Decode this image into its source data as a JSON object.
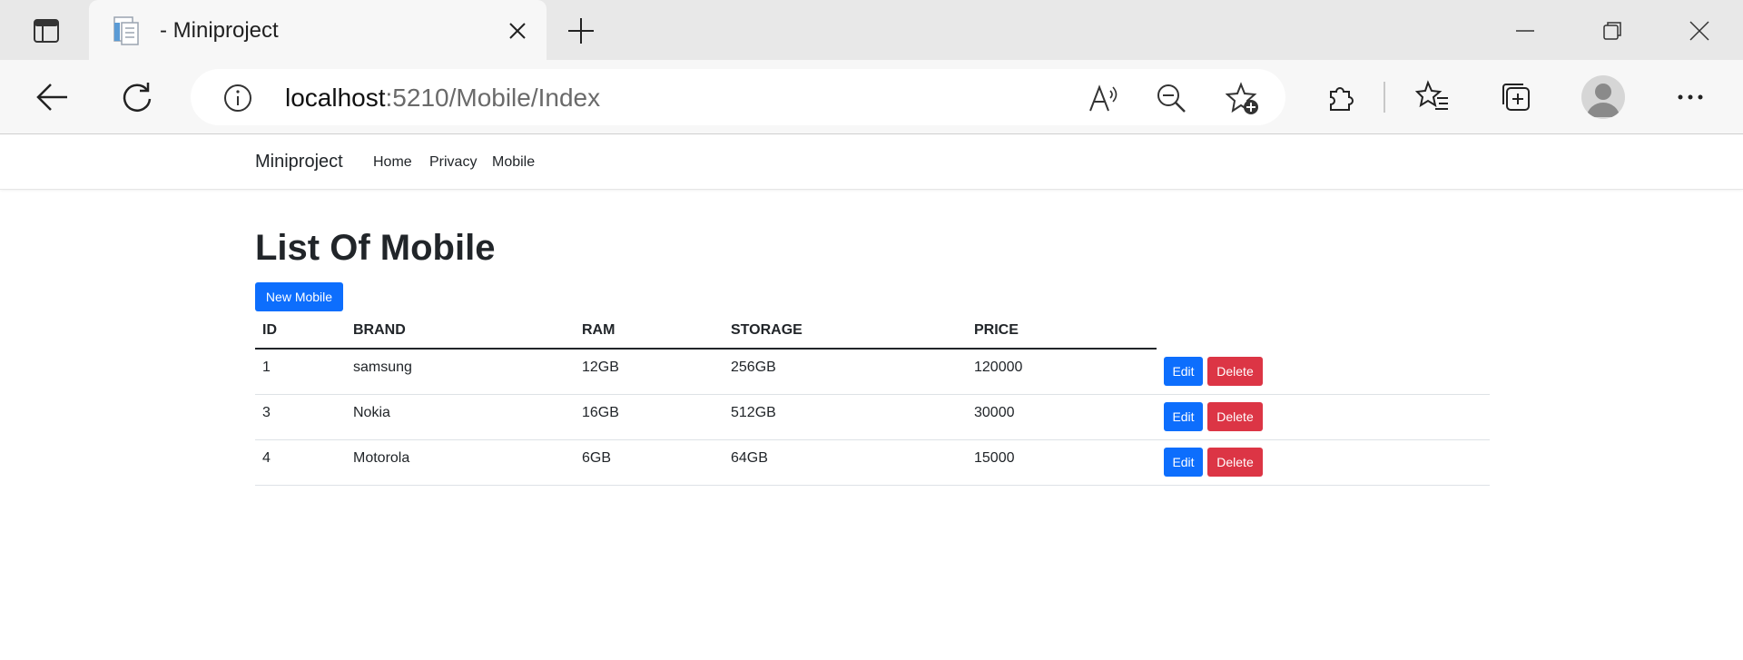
{
  "browser": {
    "tab_title": "- Miniproject",
    "url_host": "localhost",
    "url_path": ":5210/Mobile/Index",
    "icons": [
      "sidebar-icon",
      "page-favicon-icon",
      "close-icon",
      "plus-icon",
      "minimize-icon",
      "restore-icon",
      "close-window-icon",
      "back-icon",
      "refresh-icon",
      "info-icon",
      "read-aloud-icon",
      "zoom-out-icon",
      "add-favorite-icon",
      "extensions-icon",
      "favorites-icon",
      "collections-icon",
      "avatar-icon",
      "more-icon"
    ]
  },
  "navbar": {
    "brand": "Miniproject",
    "links": [
      "Home",
      "Privacy",
      "Mobile"
    ]
  },
  "main": {
    "heading": "List Of Mobile",
    "new_button": "New Mobile",
    "columns": [
      "ID",
      "BRAND",
      "RAM",
      "STORAGE",
      "PRICE"
    ],
    "rows": [
      {
        "id": "1",
        "brand": "samsung",
        "ram": "12GB",
        "storage": "256GB",
        "price": "120000",
        "edit": "Edit",
        "delete": "Delete"
      },
      {
        "id": "3",
        "brand": "Nokia",
        "ram": "16GB",
        "storage": "512GB",
        "price": "30000",
        "edit": "Edit",
        "delete": "Delete"
      },
      {
        "id": "4",
        "brand": "Motorola",
        "ram": "6GB",
        "storage": "64GB",
        "price": "15000",
        "edit": "Edit",
        "delete": "Delete"
      }
    ]
  },
  "colors": {
    "primary": "#0d6efd",
    "danger": "#dc3545"
  }
}
